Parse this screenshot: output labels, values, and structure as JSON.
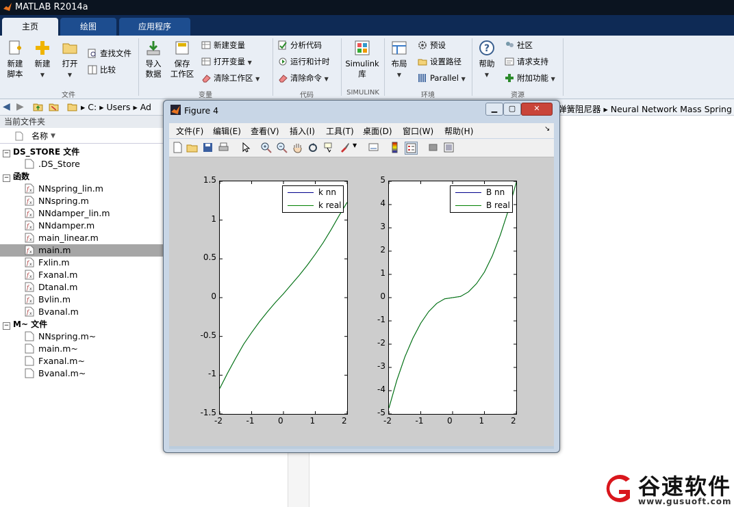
{
  "app": {
    "title": "MATLAB R2014a"
  },
  "tabs": [
    "主页",
    "绘图",
    "应用程序"
  ],
  "ribbon": {
    "file": {
      "new_script": [
        "新建",
        "脚本"
      ],
      "new": "新建",
      "open": "打开",
      "find_files": "查找文件",
      "compare": "比较",
      "group": "文件"
    },
    "variable": {
      "import": [
        "导入",
        "数据"
      ],
      "save": [
        "保存",
        "工作区"
      ],
      "new_var": "新建变量",
      "open_var": "打开变量",
      "clear_ws": "清除工作区",
      "group": "变量"
    },
    "code": {
      "analyze": "分析代码",
      "run_time": "运行和计时",
      "clear_cmd": "清除命令",
      "group": "代码"
    },
    "simulink": {
      "lib": [
        "Simulink",
        "库"
      ],
      "group": "SIMULINK"
    },
    "env": {
      "layout": "布局",
      "prefs": "预设",
      "set_path": "设置路径",
      "parallel": "Parallel",
      "group": "环境"
    },
    "resources": {
      "help": "帮助",
      "community": "社区",
      "support": "请求支持",
      "addons": "附加功能",
      "group": "资源"
    }
  },
  "address": {
    "crumbs": [
      "C:",
      "Users",
      "Ad"
    ],
    "tail": [
      "弹簧阻尼器",
      "Neural Network Mass Spring"
    ]
  },
  "file_panel": {
    "header": "当前文件夹",
    "col_name": "名称",
    "sections": [
      {
        "title": "DS_STORE 文件",
        "items": [
          ".DS_Store"
        ]
      },
      {
        "title": "函数",
        "items": [
          "NNspring_lin.m",
          "NNspring.m",
          "NNdamper_lin.m",
          "NNdamper.m",
          "main_linear.m",
          "main.m",
          "Fxlin.m",
          "Fxanal.m",
          "Dtanal.m",
          "Bvlin.m",
          "Bvanal.m"
        ]
      },
      {
        "title": "M~ 文件",
        "items": [
          "NNspring.m~",
          "main.m~",
          "Fxanal.m~",
          "Bvanal.m~"
        ]
      }
    ],
    "selected": "main.m"
  },
  "figure": {
    "title": "Figure 4",
    "menu": [
      "文件(F)",
      "编辑(E)",
      "查看(V)",
      "插入(I)",
      "工具(T)",
      "桌面(D)",
      "窗口(W)",
      "帮助(H)"
    ]
  },
  "chart_data": [
    {
      "type": "line",
      "xlim": [
        -2,
        2
      ],
      "ylim": [
        -1.5,
        1.5
      ],
      "xticks": [
        "-2",
        "-1",
        "0",
        "1",
        "2"
      ],
      "yticks": [
        "1.5",
        "1",
        "0.5",
        "0",
        "-0.5",
        "-1",
        "-1.5"
      ],
      "legend": {
        "placement": "top-right",
        "entries": [
          {
            "label": "k nn",
            "color": "#00008b"
          },
          {
            "label": "k real",
            "color": "#008000"
          }
        ]
      },
      "series": [
        {
          "name": "k nn",
          "color": "#00008b",
          "x": [
            -2,
            -1.75,
            -1.5,
            -1.25,
            -1,
            -0.75,
            -0.5,
            -0.25,
            0,
            0.25,
            0.5,
            0.75,
            1,
            1.25,
            1.5,
            1.75,
            2
          ],
          "y": [
            -1.17,
            -0.97,
            -0.78,
            -0.6,
            -0.45,
            -0.31,
            -0.18,
            -0.06,
            0.05,
            0.17,
            0.29,
            0.42,
            0.56,
            0.71,
            0.88,
            1.06,
            1.23
          ]
        },
        {
          "name": "k real",
          "color": "#008000",
          "x": [
            -2,
            -1.75,
            -1.5,
            -1.25,
            -1,
            -0.75,
            -0.5,
            -0.25,
            0,
            0.25,
            0.5,
            0.75,
            1,
            1.25,
            1.5,
            1.75,
            2
          ],
          "y": [
            -1.17,
            -0.97,
            -0.78,
            -0.6,
            -0.45,
            -0.31,
            -0.18,
            -0.06,
            0.05,
            0.17,
            0.29,
            0.42,
            0.56,
            0.71,
            0.88,
            1.06,
            1.23
          ]
        }
      ]
    },
    {
      "type": "line",
      "xlim": [
        -2,
        2
      ],
      "ylim": [
        -5,
        5
      ],
      "xticks": [
        "-2",
        "-1",
        "0",
        "1",
        "2"
      ],
      "yticks": [
        "5",
        "4",
        "3",
        "2",
        "1",
        "0",
        "-1",
        "-2",
        "-3",
        "-4",
        "-5"
      ],
      "legend": {
        "placement": "top-right",
        "entries": [
          {
            "label": "B nn",
            "color": "#00008b"
          },
          {
            "label": "B real",
            "color": "#008000"
          }
        ]
      },
      "series": [
        {
          "name": "B nn",
          "color": "#00008b",
          "x": [
            -2,
            -1.75,
            -1.5,
            -1.25,
            -1,
            -0.75,
            -0.5,
            -0.25,
            0,
            0.25,
            0.5,
            0.75,
            1,
            1.25,
            1.5,
            1.75,
            2
          ],
          "y": [
            -4.75,
            -3.55,
            -2.55,
            -1.75,
            -1.1,
            -0.6,
            -0.25,
            -0.05,
            0.0,
            0.05,
            0.25,
            0.6,
            1.1,
            1.8,
            2.7,
            3.75,
            4.95
          ]
        },
        {
          "name": "B real",
          "color": "#008000",
          "x": [
            -2,
            -1.75,
            -1.5,
            -1.25,
            -1,
            -0.75,
            -0.5,
            -0.25,
            0,
            0.25,
            0.5,
            0.75,
            1,
            1.25,
            1.5,
            1.75,
            2
          ],
          "y": [
            -4.75,
            -3.55,
            -2.55,
            -1.75,
            -1.1,
            -0.6,
            -0.25,
            -0.05,
            0.0,
            0.05,
            0.25,
            0.6,
            1.1,
            1.8,
            2.7,
            3.75,
            4.95
          ]
        }
      ]
    }
  ],
  "watermark": {
    "text": "谷速软件",
    "url": "www.gusuoft.com"
  }
}
